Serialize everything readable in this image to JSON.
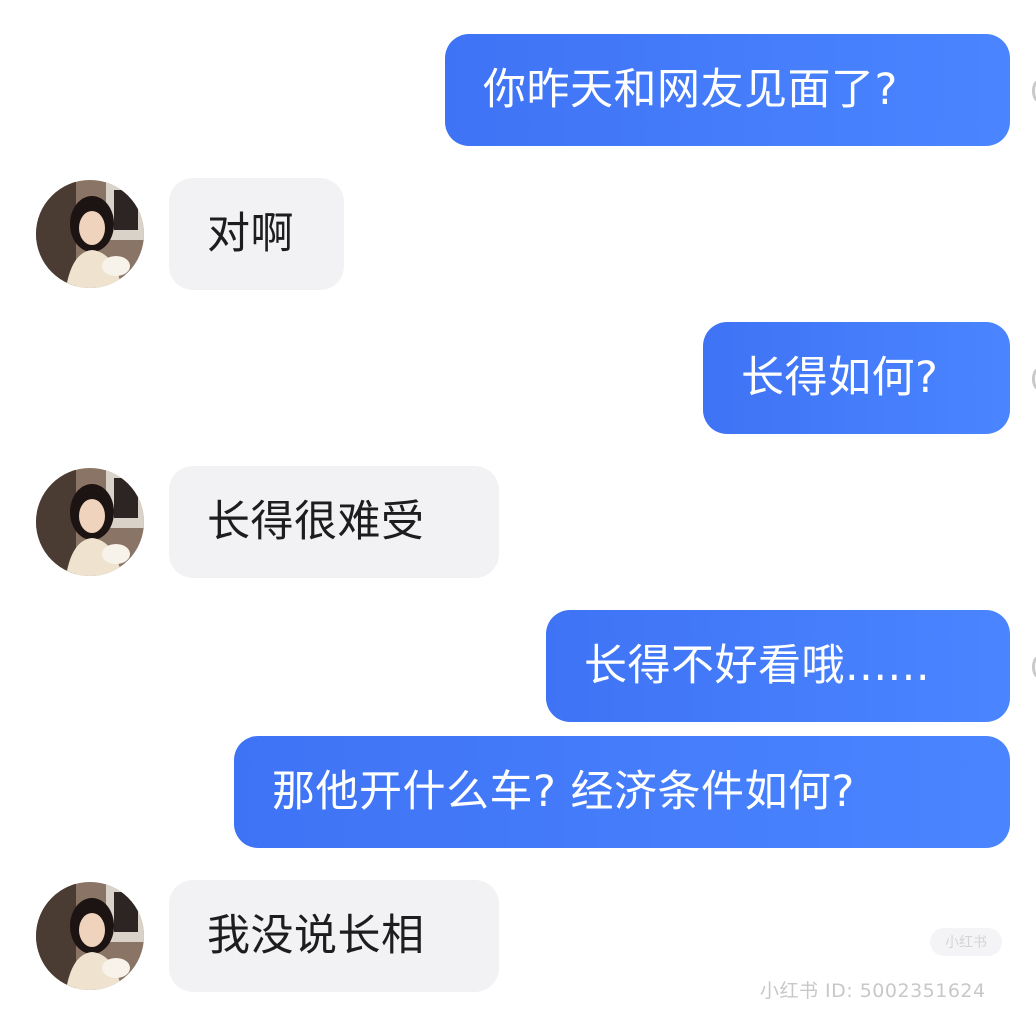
{
  "messages": [
    {
      "side": "out",
      "text": "你昨天和网友见面了?"
    },
    {
      "side": "in",
      "text": "对啊"
    },
    {
      "side": "out",
      "text": "长得如何?"
    },
    {
      "side": "in",
      "text": "长得很难受"
    },
    {
      "side": "out",
      "text": "长得不好看哦......"
    },
    {
      "side": "out",
      "text": "那他开什么车? 经济条件如何?"
    },
    {
      "side": "in",
      "text": "我没说长相"
    }
  ],
  "watermark": {
    "text": "小红书 ID: 5002351624",
    "badge_text": "小红书"
  },
  "colors": {
    "outgoing_bubble": "#4a85ff",
    "incoming_bubble": "#f2f2f4",
    "incoming_text": "#1d1d1f",
    "outgoing_text": "#ffffff"
  },
  "icons": {
    "avatar": "girl-photo-avatar"
  }
}
